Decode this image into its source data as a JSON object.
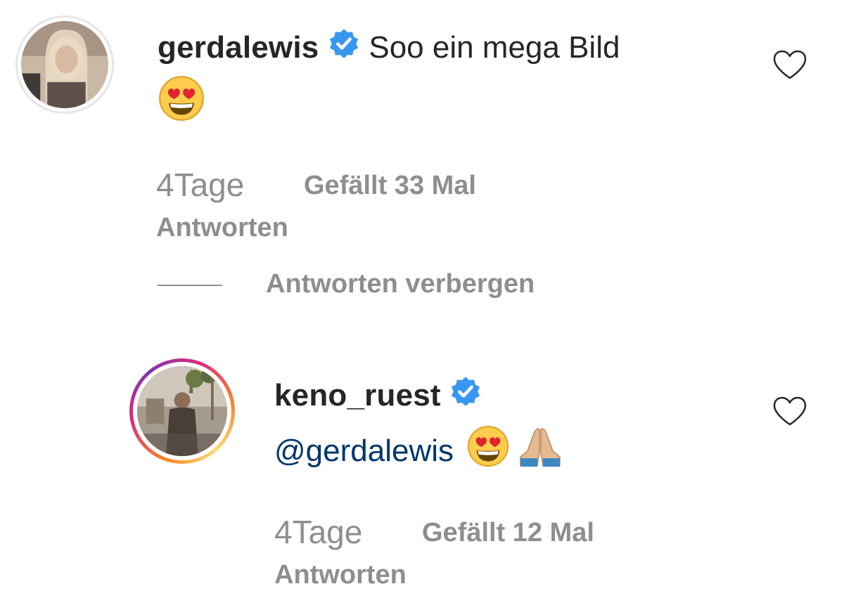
{
  "comments": [
    {
      "username": "gerdalewis",
      "verified": true,
      "text": "Soo ein mega Bild",
      "emoji": [
        "heart-eyes-emoji"
      ],
      "time": "4Tage",
      "likes": "Gefällt 33 Mal",
      "reply_label": "Antworten"
    }
  ],
  "thread": {
    "hide_replies_label": "Antworten verbergen"
  },
  "replies": [
    {
      "username": "keno_ruest",
      "verified": true,
      "mention": "@gerdalewis",
      "emoji": [
        "heart-eyes-emoji",
        "folded-hands-emoji"
      ],
      "time": "4Tage",
      "likes": "Gefällt 12 Mal",
      "reply_label": "Antworten",
      "story_ring": true
    }
  ],
  "colors": {
    "verified_badge": "#3897f0",
    "mention": "#00376b",
    "secondary_text": "#8e8e8e",
    "primary_text": "#262626"
  }
}
